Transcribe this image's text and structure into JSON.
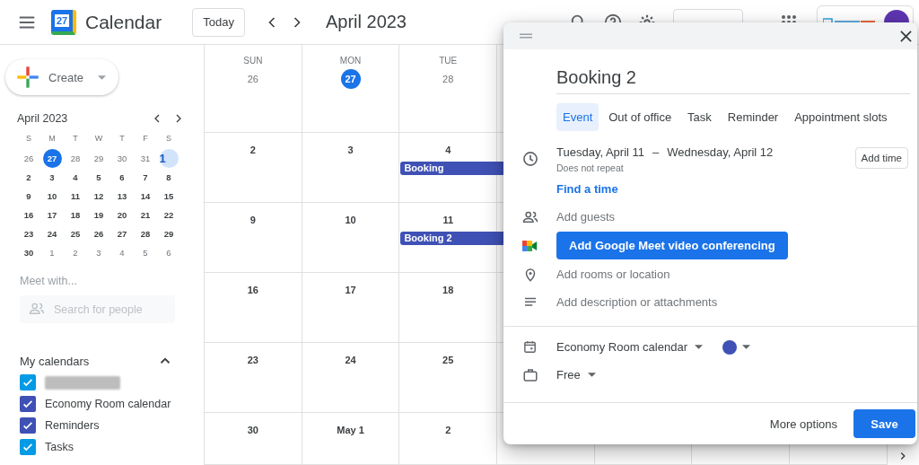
{
  "header": {
    "logo_day": "27",
    "app_name": "Calendar",
    "today_button": "Today",
    "period": "April 2023"
  },
  "sidebar": {
    "create_button": "Create",
    "mini_calendar": {
      "title": "April 2023",
      "weekdays": [
        "S",
        "M",
        "T",
        "W",
        "T",
        "F",
        "S"
      ],
      "weeks": [
        [
          {
            "day": "26",
            "muted": true,
            "today": false,
            "selected": false
          },
          {
            "day": "27",
            "muted": true,
            "today": true,
            "selected": false
          },
          {
            "day": "28",
            "muted": true,
            "today": false,
            "selected": false
          },
          {
            "day": "29",
            "muted": true,
            "today": false,
            "selected": false
          },
          {
            "day": "30",
            "muted": true,
            "today": false,
            "selected": false
          },
          {
            "day": "31",
            "muted": true,
            "today": false,
            "selected": false
          },
          {
            "day": "1",
            "muted": false,
            "today": false,
            "selected": true
          }
        ],
        [
          {
            "day": "2",
            "muted": false,
            "today": false,
            "selected": false
          },
          {
            "day": "3",
            "muted": false,
            "today": false,
            "selected": false
          },
          {
            "day": "4",
            "muted": false,
            "today": false,
            "selected": false
          },
          {
            "day": "5",
            "muted": false,
            "today": false,
            "selected": false
          },
          {
            "day": "6",
            "muted": false,
            "today": false,
            "selected": false
          },
          {
            "day": "7",
            "muted": false,
            "today": false,
            "selected": false
          },
          {
            "day": "8",
            "muted": false,
            "today": false,
            "selected": false
          }
        ],
        [
          {
            "day": "9",
            "muted": false,
            "today": false,
            "selected": false
          },
          {
            "day": "10",
            "muted": false,
            "today": false,
            "selected": false
          },
          {
            "day": "11",
            "muted": false,
            "today": false,
            "selected": false
          },
          {
            "day": "12",
            "muted": false,
            "today": false,
            "selected": false
          },
          {
            "day": "13",
            "muted": false,
            "today": false,
            "selected": false
          },
          {
            "day": "14",
            "muted": false,
            "today": false,
            "selected": false
          },
          {
            "day": "15",
            "muted": false,
            "today": false,
            "selected": false
          }
        ],
        [
          {
            "day": "16",
            "muted": false,
            "today": false,
            "selected": false
          },
          {
            "day": "17",
            "muted": false,
            "today": false,
            "selected": false
          },
          {
            "day": "18",
            "muted": false,
            "today": false,
            "selected": false
          },
          {
            "day": "19",
            "muted": false,
            "today": false,
            "selected": false
          },
          {
            "day": "20",
            "muted": false,
            "today": false,
            "selected": false
          },
          {
            "day": "21",
            "muted": false,
            "today": false,
            "selected": false
          },
          {
            "day": "22",
            "muted": false,
            "today": false,
            "selected": false
          }
        ],
        [
          {
            "day": "23",
            "muted": false,
            "today": false,
            "selected": false
          },
          {
            "day": "24",
            "muted": false,
            "today": false,
            "selected": false
          },
          {
            "day": "25",
            "muted": false,
            "today": false,
            "selected": false
          },
          {
            "day": "26",
            "muted": false,
            "today": false,
            "selected": false
          },
          {
            "day": "27",
            "muted": false,
            "today": false,
            "selected": false
          },
          {
            "day": "28",
            "muted": false,
            "today": false,
            "selected": false
          },
          {
            "day": "29",
            "muted": false,
            "today": false,
            "selected": false
          }
        ],
        [
          {
            "day": "30",
            "muted": false,
            "today": false,
            "selected": false
          },
          {
            "day": "1",
            "muted": true,
            "today": false,
            "selected": false
          },
          {
            "day": "2",
            "muted": true,
            "today": false,
            "selected": false
          },
          {
            "day": "3",
            "muted": true,
            "today": false,
            "selected": false
          },
          {
            "day": "4",
            "muted": true,
            "today": false,
            "selected": false
          },
          {
            "day": "5",
            "muted": true,
            "today": false,
            "selected": false
          },
          {
            "day": "6",
            "muted": true,
            "today": false,
            "selected": false
          }
        ]
      ]
    },
    "meet_with": {
      "title": "Meet with...",
      "placeholder": "Search for people"
    },
    "my_calendars": {
      "title": "My calendars",
      "expanded": true,
      "items": [
        {
          "kind": "redacted",
          "checked": true,
          "color": "#039be5"
        },
        {
          "kind": "named",
          "label": "Economy Room calendar",
          "checked": true,
          "color": "#3f51b5"
        },
        {
          "kind": "named",
          "label": "Reminders",
          "checked": true,
          "color": "#3f51b5"
        },
        {
          "kind": "named",
          "label": "Tasks",
          "checked": true,
          "color": "#039be5"
        }
      ]
    }
  },
  "month_grid": {
    "weekdays": [
      "SUN",
      "MON",
      "TUE"
    ],
    "weeks": [
      {
        "days": [
          {
            "day": "26",
            "today": false
          },
          {
            "day": "27",
            "today": true
          },
          {
            "day": "28",
            "today": false
          }
        ]
      },
      {
        "days": [
          {
            "day": "2",
            "today": false
          },
          {
            "day": "3",
            "today": false
          },
          {
            "day": "4",
            "today": false,
            "events": [
              {
                "title": "Booking",
                "color": "#3f51b5"
              }
            ]
          }
        ]
      },
      {
        "days": [
          {
            "day": "9",
            "today": false
          },
          {
            "day": "10",
            "today": false
          },
          {
            "day": "11",
            "today": false,
            "events": [
              {
                "title": "Booking 2",
                "color": "#3f51b5"
              }
            ]
          }
        ]
      },
      {
        "days": [
          {
            "day": "16",
            "today": false
          },
          {
            "day": "17",
            "today": false
          },
          {
            "day": "18",
            "today": false
          }
        ]
      },
      {
        "days": [
          {
            "day": "23",
            "today": false
          },
          {
            "day": "24",
            "today": false
          },
          {
            "day": "25",
            "today": false
          }
        ]
      },
      {
        "days": [
          {
            "day": "30",
            "today": false
          },
          {
            "day": "May 1",
            "today": false
          },
          {
            "day": "2",
            "today": false
          }
        ]
      }
    ]
  },
  "event_dialog": {
    "title": "Booking 2",
    "tabs": [
      {
        "label": "Event",
        "selected": true
      },
      {
        "label": "Out of office",
        "selected": false
      },
      {
        "label": "Task",
        "selected": false
      },
      {
        "label": "Reminder",
        "selected": false
      },
      {
        "label": "Appointment slots",
        "selected": false
      }
    ],
    "start_date": "Tuesday, April 11",
    "separator": "–",
    "end_date": "Wednesday, April 12",
    "recurrence": "Does not repeat",
    "add_time_button": "Add time",
    "find_time_link": "Find a time",
    "guests_placeholder": "Add guests",
    "meet_button": "Add Google Meet video conferencing",
    "location_placeholder": "Add rooms or location",
    "description_placeholder": "Add description or attachments",
    "calendar_select": {
      "label": "Economy Room calendar",
      "color": "#3f51b5"
    },
    "availability_select": "Free",
    "more_options_button": "More options",
    "save_button": "Save"
  }
}
